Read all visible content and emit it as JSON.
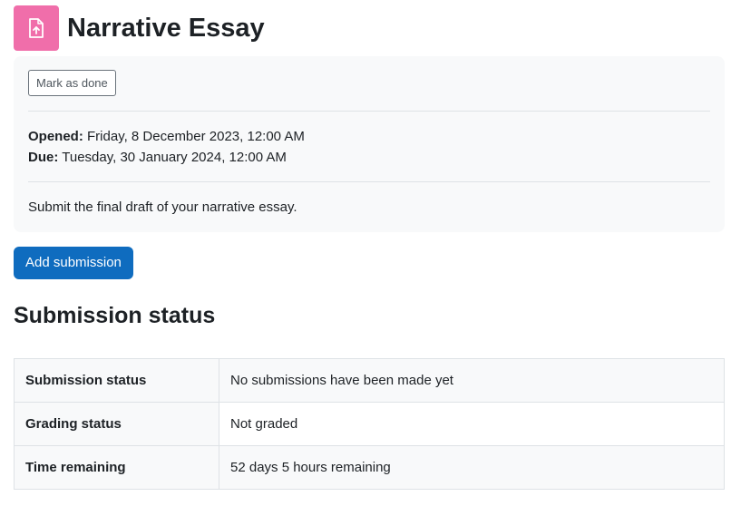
{
  "header": {
    "icon": "assignment-upload-icon",
    "icon_color": "#f06eaa",
    "title": "Narrative Essay"
  },
  "info": {
    "mark_done_label": "Mark as done",
    "opened_label": "Opened:",
    "opened_value": "Friday, 8 December 2023, 12:00 AM",
    "due_label": "Due:",
    "due_value": "Tuesday, 30 January 2024, 12:00 AM",
    "intro": "Submit the final draft of your narrative essay."
  },
  "actions": {
    "add_submission_label": "Add submission",
    "primary_color": "#0f6cbf"
  },
  "submission": {
    "section_title": "Submission status",
    "rows": [
      {
        "label": "Submission status",
        "value": "No submissions have been made yet"
      },
      {
        "label": "Grading status",
        "value": "Not graded"
      },
      {
        "label": "Time remaining",
        "value": "52 days 5 hours remaining"
      }
    ]
  }
}
